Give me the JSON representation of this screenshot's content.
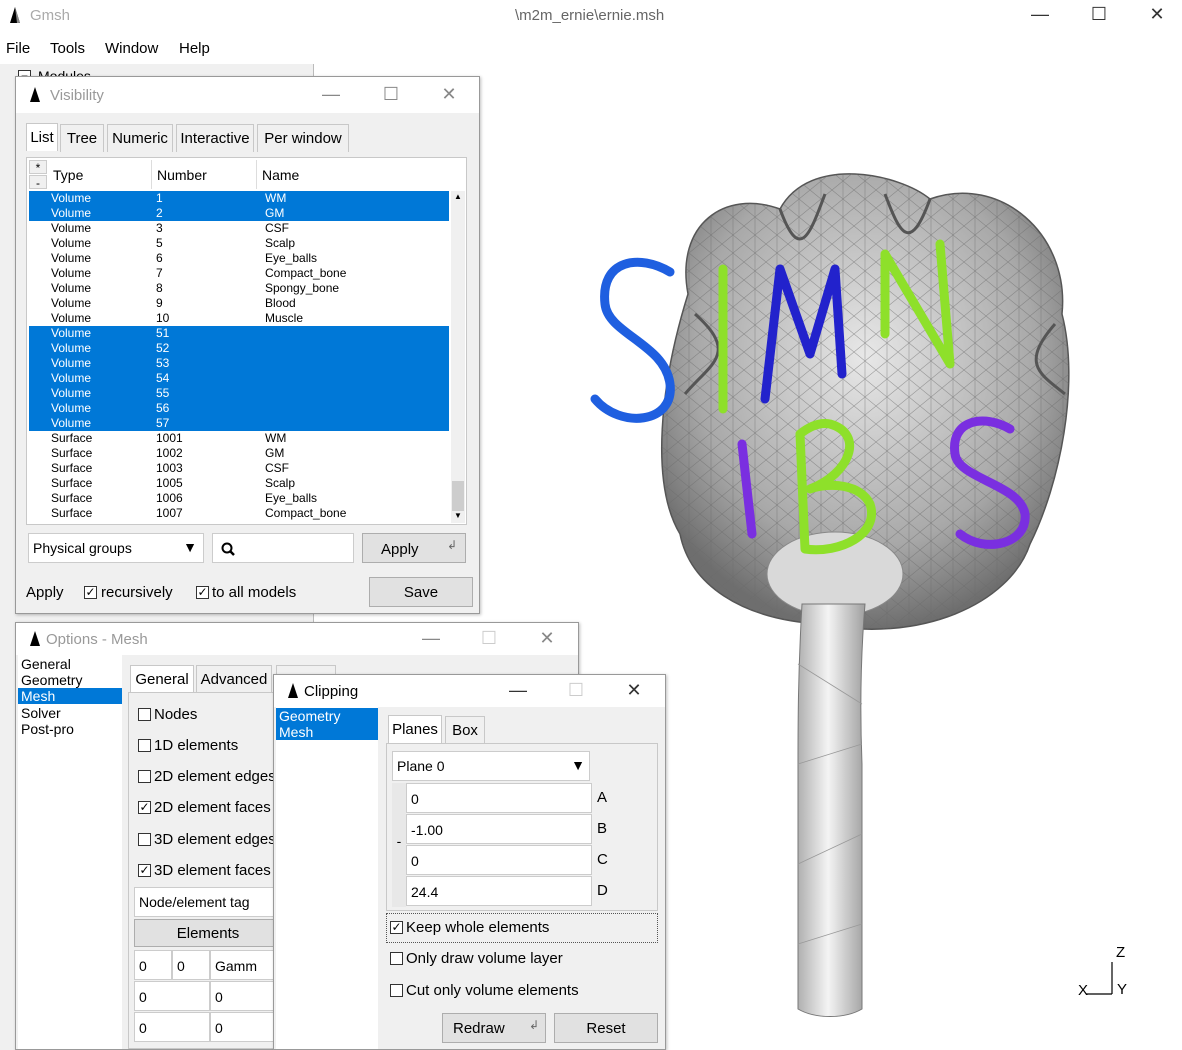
{
  "app": {
    "name": "Gmsh",
    "title": "\\m2m_ernie\\ernie.msh"
  },
  "menu": [
    "File",
    "Tools",
    "Window",
    "Help"
  ],
  "under": {
    "modules": "Modules"
  },
  "visibility": {
    "title": "Visibility",
    "tabs": [
      "List",
      "Tree",
      "Numeric",
      "Interactive",
      "Per window"
    ],
    "headers": {
      "star": "*",
      "minus": "-",
      "type": "Type",
      "number": "Number",
      "name": "Name"
    },
    "rows": [
      {
        "type": "Volume",
        "number": "1",
        "name": "WM",
        "selected": true
      },
      {
        "type": "Volume",
        "number": "2",
        "name": "GM",
        "selected": true
      },
      {
        "type": "Volume",
        "number": "3",
        "name": "CSF",
        "selected": false
      },
      {
        "type": "Volume",
        "number": "5",
        "name": "Scalp",
        "selected": false
      },
      {
        "type": "Volume",
        "number": "6",
        "name": "Eye_balls",
        "selected": false
      },
      {
        "type": "Volume",
        "number": "7",
        "name": "Compact_bone",
        "selected": false
      },
      {
        "type": "Volume",
        "number": "8",
        "name": "Spongy_bone",
        "selected": false
      },
      {
        "type": "Volume",
        "number": "9",
        "name": "Blood",
        "selected": false
      },
      {
        "type": "Volume",
        "number": "10",
        "name": "Muscle",
        "selected": false
      },
      {
        "type": "Volume",
        "number": "51",
        "name": "",
        "selected": true
      },
      {
        "type": "Volume",
        "number": "52",
        "name": "",
        "selected": true
      },
      {
        "type": "Volume",
        "number": "53",
        "name": "",
        "selected": true
      },
      {
        "type": "Volume",
        "number": "54",
        "name": "",
        "selected": true
      },
      {
        "type": "Volume",
        "number": "55",
        "name": "",
        "selected": true
      },
      {
        "type": "Volume",
        "number": "56",
        "name": "",
        "selected": true
      },
      {
        "type": "Volume",
        "number": "57",
        "name": "",
        "selected": true
      },
      {
        "type": "Surface",
        "number": "1001",
        "name": "WM",
        "selected": false
      },
      {
        "type": "Surface",
        "number": "1002",
        "name": "GM",
        "selected": false
      },
      {
        "type": "Surface",
        "number": "1003",
        "name": "CSF",
        "selected": false
      },
      {
        "type": "Surface",
        "number": "1005",
        "name": "Scalp",
        "selected": false
      },
      {
        "type": "Surface",
        "number": "1006",
        "name": "Eye_balls",
        "selected": false
      },
      {
        "type": "Surface",
        "number": "1007",
        "name": "Compact_bone",
        "selected": false
      }
    ],
    "group_select": "Physical groups",
    "search_value": "",
    "apply_button": "Apply",
    "apply_label": "Apply",
    "recursively": "recursively",
    "to_all_models": "to all models",
    "save_button": "Save"
  },
  "options": {
    "title": "Options - Mesh",
    "sidebar": [
      "General",
      "Geometry",
      "Mesh",
      "Solver",
      "Post-pro"
    ],
    "tabs": [
      "General",
      "Advanced"
    ],
    "checks": [
      {
        "label": "Nodes",
        "checked": false
      },
      {
        "label": "1D elements",
        "checked": false
      },
      {
        "label": "2D element edges",
        "checked": false
      },
      {
        "label": "2D element faces",
        "checked": true
      },
      {
        "label": "3D element edges",
        "checked": false
      },
      {
        "label": "3D element faces",
        "checked": true
      }
    ],
    "label_select": "Node/element tag",
    "elements_button": "Elements",
    "grid": [
      [
        "0",
        "0",
        "Gamm"
      ],
      [
        "0",
        "0"
      ],
      [
        "0",
        "0"
      ]
    ]
  },
  "clipping": {
    "title": "Clipping",
    "sidebar": [
      "Geometry",
      "Mesh"
    ],
    "tabs": [
      "Planes",
      "Box"
    ],
    "plane_select": "Plane 0",
    "minus": "-",
    "fields": [
      {
        "value": "0",
        "label": "A"
      },
      {
        "value": "-1.00",
        "label": "B"
      },
      {
        "value": "0",
        "label": "C"
      },
      {
        "value": "24.4",
        "label": "D"
      }
    ],
    "keep_whole": "Keep whole elements",
    "only_volume": "Only draw volume layer",
    "cut_volume": "Cut only volume elements",
    "redraw_button": "Redraw",
    "reset_button": "Reset"
  },
  "axes": {
    "z": "Z",
    "x": "X",
    "y": "Y"
  },
  "overlay_letters": [
    "S",
    "I",
    "M",
    "N",
    "I",
    "B",
    "S"
  ],
  "colors": {
    "selection": "#0078d7",
    "blue": "#1f5fe0",
    "lime": "#8ee02a",
    "navy": "#2222cc",
    "purple": "#7a2fe0"
  }
}
